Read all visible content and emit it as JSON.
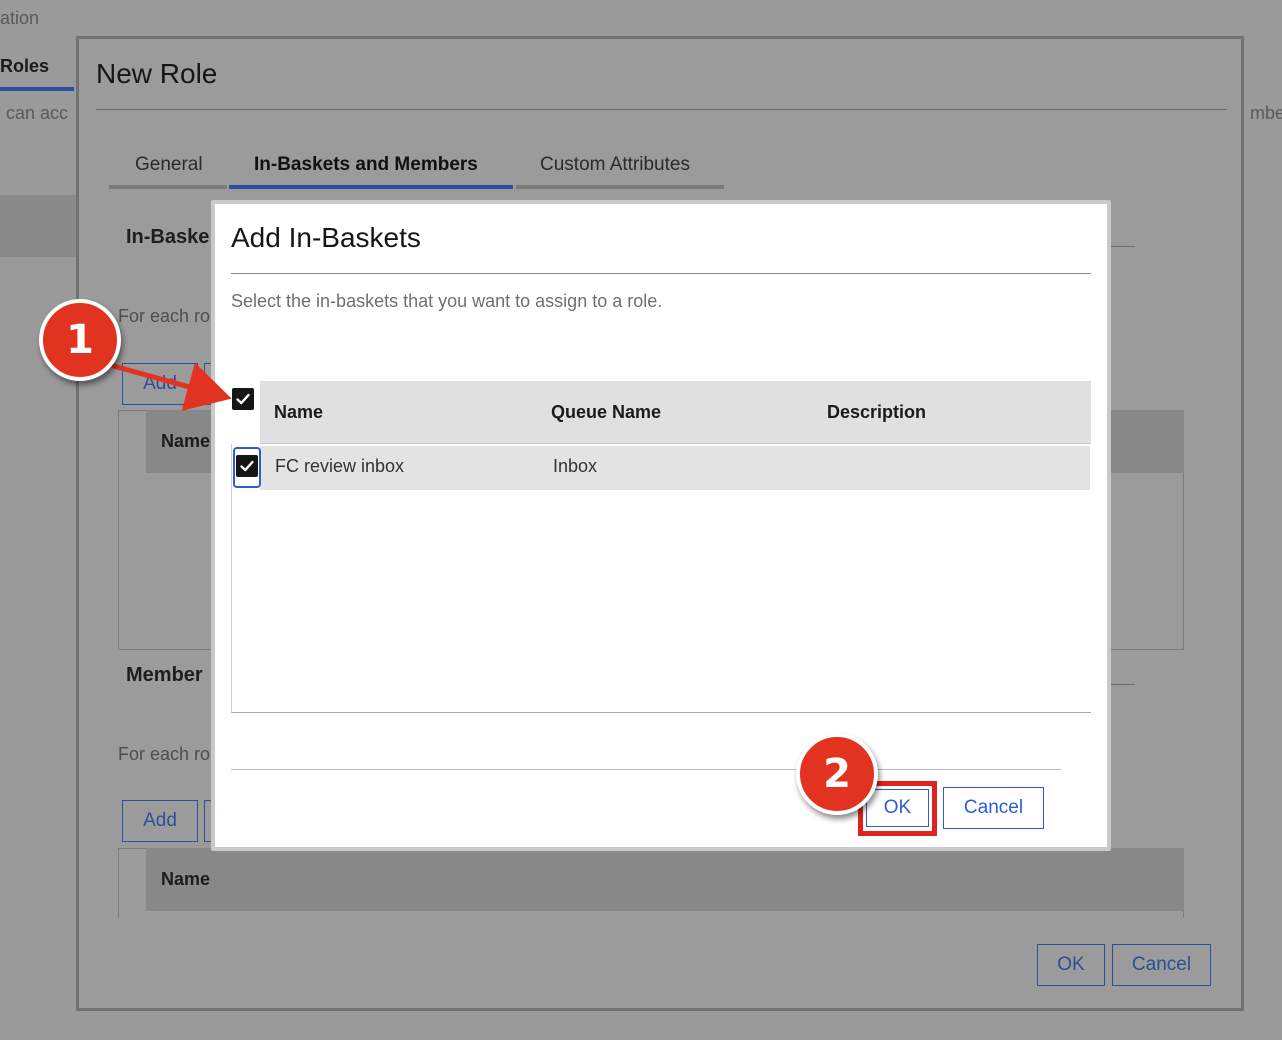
{
  "background": {
    "title_fragment": "ation",
    "roles_tab": "Roles",
    "left_desc_fragment": "can acc",
    "right_desc_fragment": "mbe"
  },
  "role_modal": {
    "title": "New Role",
    "tabs": [
      {
        "label": "General"
      },
      {
        "label": "In-Baskets and Members"
      },
      {
        "label": "Custom Attributes"
      }
    ],
    "active_tab": "In-Baskets and Members",
    "inbaskets_section": {
      "heading": "In-Baske",
      "desc": "For each ro",
      "add_button": "Add",
      "table_col": "Name"
    },
    "members_section": {
      "heading": "Member",
      "desc": "For each ro",
      "add_button": "Add",
      "table_col": "Name"
    },
    "ok_button": "OK",
    "cancel_button": "Cancel"
  },
  "dialog": {
    "title": "Add In-Baskets",
    "description": "Select the in-baskets that you want to assign to a role.",
    "columns": [
      "Name",
      "Queue Name",
      "Description"
    ],
    "select_all_checked": true,
    "rows": [
      {
        "name": "FC review inbox",
        "queue_name": "Inbox",
        "description": "",
        "checked": true
      }
    ],
    "ok_button": "OK",
    "cancel_button": "Cancel"
  },
  "callouts": [
    {
      "number": "1",
      "target": "select-all-checkbox"
    },
    {
      "number": "2",
      "target": "dialog-ok-button"
    }
  ],
  "colors": {
    "accent": "#2f5cd6",
    "callout": "#e1331f",
    "highlight": "#e0231c"
  }
}
